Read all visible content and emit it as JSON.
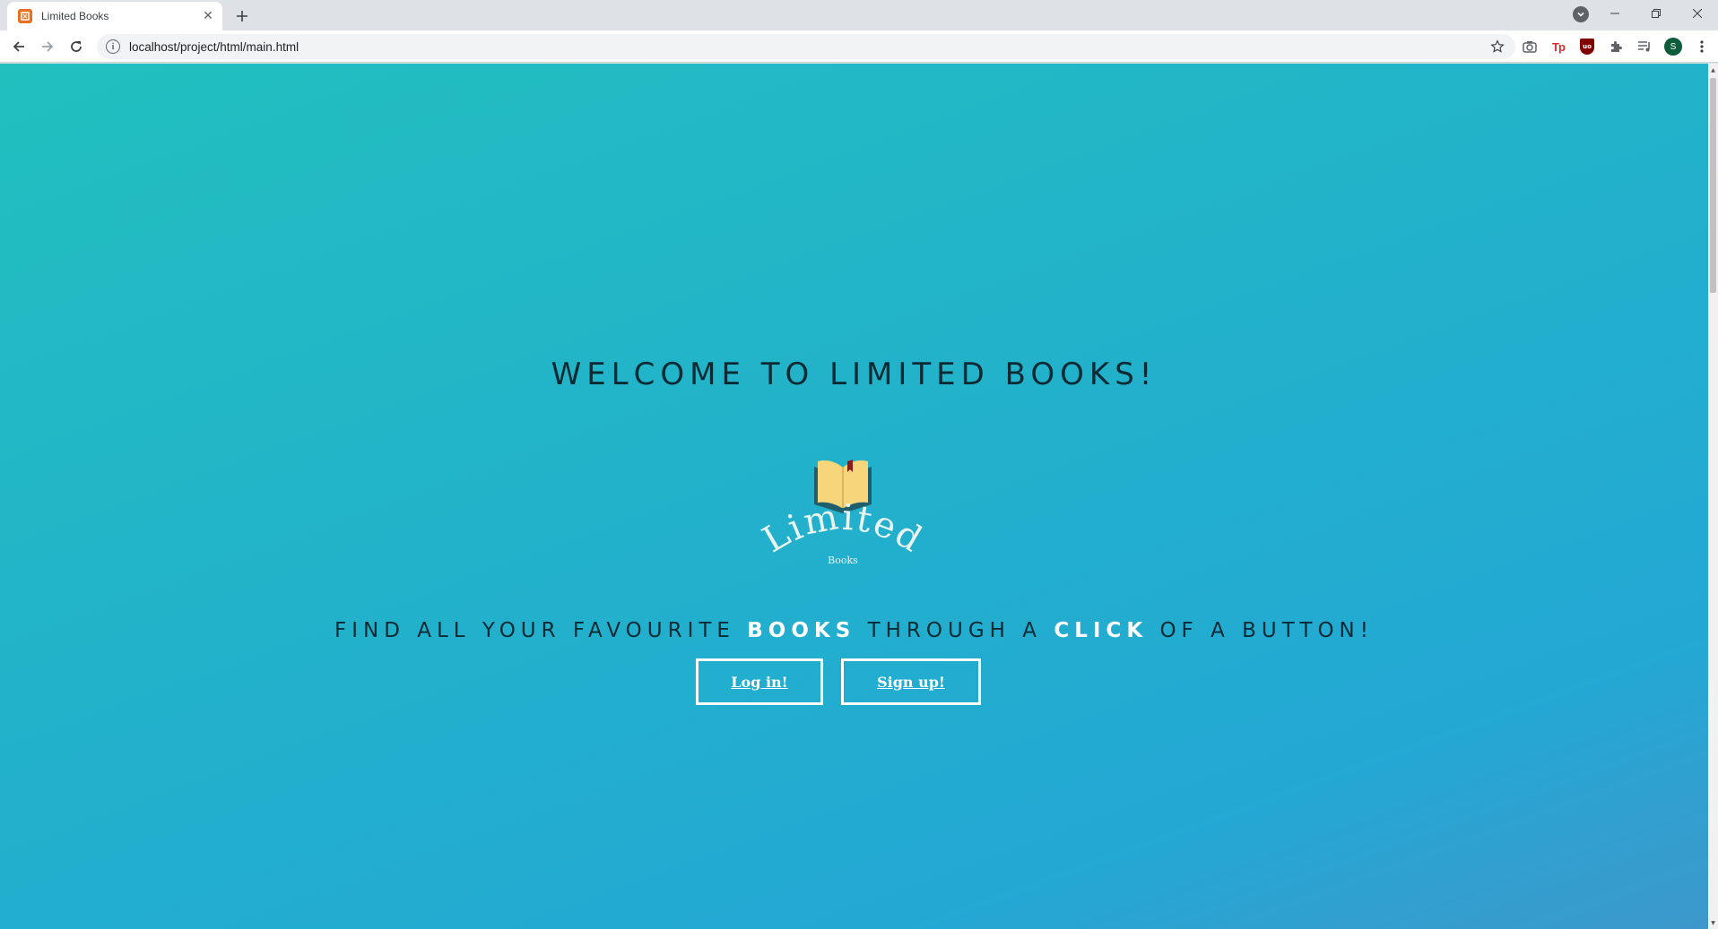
{
  "browser": {
    "tab_title": "Limited Books",
    "url": "localhost/project/html/main.html",
    "profile_initial": "S",
    "extensions": [
      "camera-icon",
      "tp-extension-icon",
      "ublock-icon",
      "puzzle-icon",
      "media-control-icon"
    ]
  },
  "page": {
    "welcome": "WELCOME TO LIMITED BOOKS!",
    "logo_title": "Limited",
    "logo_subtitle": "Books",
    "tagline_parts": [
      "FIND ALL YOUR FAVOURITE ",
      "BOOKS",
      " THROUGH A ",
      "CLICK",
      " OF A BUTTON!"
    ],
    "login_label": "Log in!",
    "signup_label": "Sign up!"
  },
  "colors": {
    "gradient_start": "#21c0bf",
    "gradient_end": "#3d98cc",
    "book_cover": "#1f5f6b",
    "book_pages": "#f7d57a",
    "bookmark": "#8b1a1a"
  }
}
